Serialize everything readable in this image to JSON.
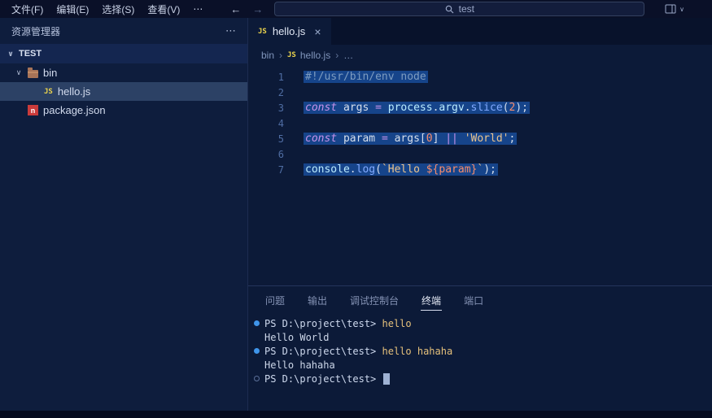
{
  "titlebar": {
    "menus": [
      {
        "label": "文件(F)",
        "name": "file"
      },
      {
        "label": "编辑(E)",
        "name": "edit"
      },
      {
        "label": "选择(S)",
        "name": "selection"
      },
      {
        "label": "查看(V)",
        "name": "view"
      },
      {
        "label": "⋯",
        "name": "more"
      }
    ],
    "nav": {
      "back": "←",
      "forward": "→"
    },
    "search": {
      "value": "test"
    },
    "layout_chevron": "∨"
  },
  "sidebar": {
    "title": "资源管理器",
    "more": "⋯",
    "section": {
      "label": "TEST",
      "chevron": "∨"
    },
    "items": [
      {
        "label": "bin",
        "name": "bin",
        "icon": "folder",
        "indent": 1,
        "chevron": "∨",
        "selected": false
      },
      {
        "label": "hello.js",
        "name": "hello-js",
        "icon": "js",
        "indent": 2,
        "chevron": null,
        "selected": true
      },
      {
        "label": "package.json",
        "name": "package-json",
        "icon": "npm",
        "indent": 1,
        "chevron": null,
        "selected": false
      }
    ]
  },
  "editor": {
    "tab": {
      "label": "hello.js",
      "close": "×",
      "icon": "JS"
    },
    "breadcrumbs": [
      {
        "label": "bin",
        "icon": null
      },
      {
        "label": "hello.js",
        "icon": "JS"
      },
      {
        "label": "…",
        "icon": null
      }
    ],
    "crumb_separator": "›",
    "lines": [
      {
        "num": "1",
        "tokens": [
          [
            "#!/usr/bin/env node",
            "cmt"
          ]
        ]
      },
      {
        "num": "2",
        "tokens": []
      },
      {
        "num": "3",
        "tokens": [
          [
            "const",
            "kw"
          ],
          [
            " ",
            ""
          ],
          [
            "args",
            "var"
          ],
          [
            " ",
            ""
          ],
          [
            "=",
            "op"
          ],
          [
            " ",
            ""
          ],
          [
            "process",
            "obj"
          ],
          [
            ".",
            "pn"
          ],
          [
            "argv",
            "obj"
          ],
          [
            ".",
            "pn"
          ],
          [
            "slice",
            "fn"
          ],
          [
            "(",
            "pn"
          ],
          [
            "2",
            "num"
          ],
          [
            ")",
            "pn"
          ],
          [
            ";",
            "pn"
          ]
        ]
      },
      {
        "num": "4",
        "tokens": []
      },
      {
        "num": "5",
        "tokens": [
          [
            "const",
            "kw"
          ],
          [
            " ",
            ""
          ],
          [
            "param",
            "var"
          ],
          [
            " ",
            ""
          ],
          [
            "=",
            "op"
          ],
          [
            " ",
            ""
          ],
          [
            "args",
            "var"
          ],
          [
            "[",
            "pn"
          ],
          [
            "0",
            "num"
          ],
          [
            "]",
            "pn"
          ],
          [
            " ",
            ""
          ],
          [
            "||",
            "op"
          ],
          [
            " ",
            ""
          ],
          [
            "'World'",
            "str"
          ],
          [
            ";",
            "pn"
          ]
        ]
      },
      {
        "num": "6",
        "tokens": []
      },
      {
        "num": "7",
        "tokens": [
          [
            "console",
            "obj"
          ],
          [
            ".",
            "pn"
          ],
          [
            "log",
            "fn"
          ],
          [
            "(",
            "pn"
          ],
          [
            "`Hello ",
            "str"
          ],
          [
            "${param}",
            "interp"
          ],
          [
            "`",
            "str"
          ],
          [
            ")",
            "pn"
          ],
          [
            ";",
            "pn"
          ]
        ]
      }
    ]
  },
  "panel": {
    "tabs": [
      {
        "label": "问题",
        "name": "problems",
        "active": false
      },
      {
        "label": "输出",
        "name": "output",
        "active": false
      },
      {
        "label": "调试控制台",
        "name": "debug-console",
        "active": false
      },
      {
        "label": "终端",
        "name": "terminal",
        "active": true
      },
      {
        "label": "端口",
        "name": "ports",
        "active": false
      }
    ],
    "terminal": [
      {
        "dot": "filled",
        "cursor": false,
        "spans": [
          [
            "PS D:\\project\\test> ",
            "prompt"
          ],
          [
            "hello",
            "cmd"
          ]
        ]
      },
      {
        "dot": null,
        "cursor": false,
        "spans": [
          [
            "Hello World",
            "out"
          ]
        ]
      },
      {
        "dot": "filled",
        "cursor": false,
        "spans": [
          [
            "PS D:\\project\\test> ",
            "prompt"
          ],
          [
            "hello hahaha",
            "cmd"
          ]
        ]
      },
      {
        "dot": null,
        "cursor": false,
        "spans": [
          [
            "Hello hahaha",
            "out"
          ]
        ]
      },
      {
        "dot": "hollow",
        "cursor": true,
        "spans": [
          [
            "PS D:\\project\\test> ",
            "prompt"
          ]
        ]
      }
    ]
  },
  "colors": {
    "accent_blue": "#3f95ea",
    "code_highlight": "#16448a",
    "js_icon_yellow": "#ecd44d",
    "npm_icon_red": "#ca3b3b",
    "selected_row": "#2c4165"
  }
}
